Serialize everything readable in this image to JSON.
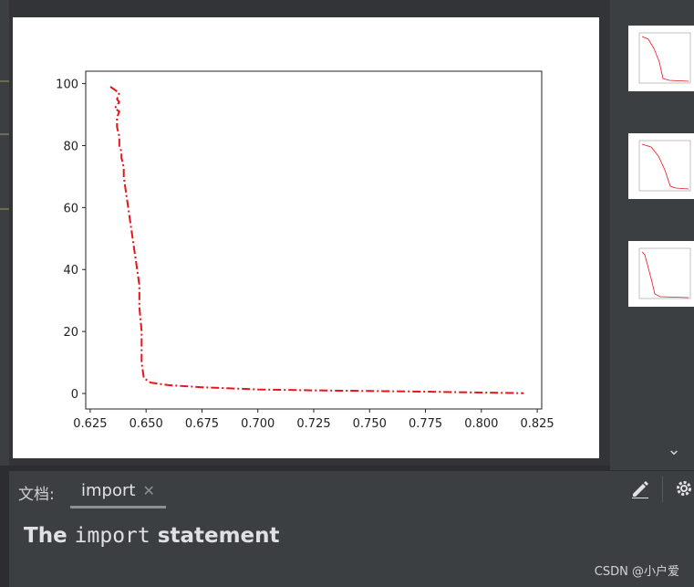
{
  "doc_panel": {
    "label": "文档:",
    "tab_label": "import",
    "close_glyph": "✕",
    "heading_prefix": "The ",
    "heading_code": "import",
    "heading_suffix": " statement",
    "edit_icon": "edit-icon",
    "gear_icon": "gear-icon"
  },
  "thumbnails": {
    "count": 3,
    "chevron": "⌄"
  },
  "watermark": "CSDN @小户爱",
  "chart_data": {
    "type": "line",
    "title": "",
    "xlabel": "",
    "ylabel": "",
    "xlim": [
      0.623,
      0.827
    ],
    "ylim": [
      -5,
      104
    ],
    "xticks": [
      0.625,
      0.65,
      0.675,
      0.7,
      0.725,
      0.75,
      0.775,
      0.8,
      0.825
    ],
    "xtick_labels": [
      "0.625",
      "0.650",
      "0.675",
      "0.700",
      "0.725",
      "0.750",
      "0.775",
      "0.800",
      "0.825"
    ],
    "yticks": [
      0,
      20,
      40,
      60,
      80,
      100
    ],
    "ytick_labels": [
      "0",
      "20",
      "40",
      "60",
      "80",
      "100"
    ],
    "grid": false,
    "color": "#e8141a",
    "linestyle": "dashdot",
    "series": [
      {
        "x": [
          0.634,
          0.636,
          0.638,
          0.637,
          0.638,
          0.636,
          0.638,
          0.637,
          0.637,
          0.638,
          0.638,
          0.639,
          0.639,
          0.64,
          0.64,
          0.641,
          0.642,
          0.643,
          0.644,
          0.645,
          0.646,
          0.647,
          0.647,
          0.648,
          0.648,
          0.649,
          0.652,
          0.66,
          0.675,
          0.7,
          0.725,
          0.75,
          0.775,
          0.8,
          0.819
        ],
        "y": [
          99,
          98,
          97,
          95,
          94,
          92,
          91,
          89,
          86,
          83,
          80,
          78,
          76,
          73,
          70,
          65,
          60,
          55,
          50,
          45,
          40,
          35,
          28,
          20,
          10,
          5,
          3.5,
          2.7,
          2.0,
          1.3,
          1.0,
          0.8,
          0.6,
          0.3,
          0.1
        ]
      }
    ]
  }
}
